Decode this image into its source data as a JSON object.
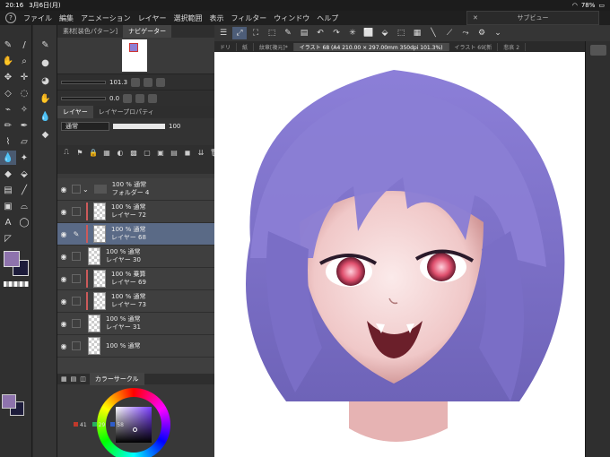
{
  "status": {
    "time": "20:16",
    "date": "3月6日(月)",
    "battery": "78%"
  },
  "menu": [
    "ファイル",
    "編集",
    "アニメーション",
    "レイヤー",
    "選択範囲",
    "表示",
    "フィルター",
    "ウィンドウ",
    "ヘルプ"
  ],
  "subview": {
    "title": "サブビュー"
  },
  "panels": {
    "top_tabs": [
      "素材[装色パターン]",
      "ナビゲーター"
    ],
    "nav_zoom": "101.3",
    "nav_rotate": "0.0",
    "layer_tabs": [
      "レイヤー",
      "レイヤープロパティ"
    ],
    "blend_mode": "通常",
    "opacity": "100"
  },
  "layers": [
    {
      "percent_mode": "100 % 通常",
      "name": "フォルダー 4",
      "type": "folder"
    },
    {
      "percent_mode": "100 % 通常",
      "name": "レイヤー 72"
    },
    {
      "percent_mode": "100 % 通常",
      "name": "レイヤー 68",
      "selected": true
    },
    {
      "percent_mode": "100 % 通常",
      "name": "レイヤー 30"
    },
    {
      "percent_mode": "100 % 乗算",
      "name": "レイヤー 69"
    },
    {
      "percent_mode": "100 % 通常",
      "name": "レイヤー 73"
    },
    {
      "percent_mode": "100 % 通常",
      "name": "レイヤー 31"
    },
    {
      "percent_mode": "100 % 通常",
      "name": ""
    }
  ],
  "color_panel": {
    "tab": "カラーサークル",
    "r": "41",
    "g": "29",
    "b": "58"
  },
  "doc_tabs": [
    "ドリ",
    "紙",
    "紋章[複元]*",
    "イラスト 68 (A4 210.00 × 297.00mm 350dpi 101.3%)",
    "イラスト 69[新",
    "悲哀 2"
  ],
  "colors": {
    "main": "#8e73ad",
    "sub": "#1d1c3b",
    "accent": "#5a6a86"
  }
}
